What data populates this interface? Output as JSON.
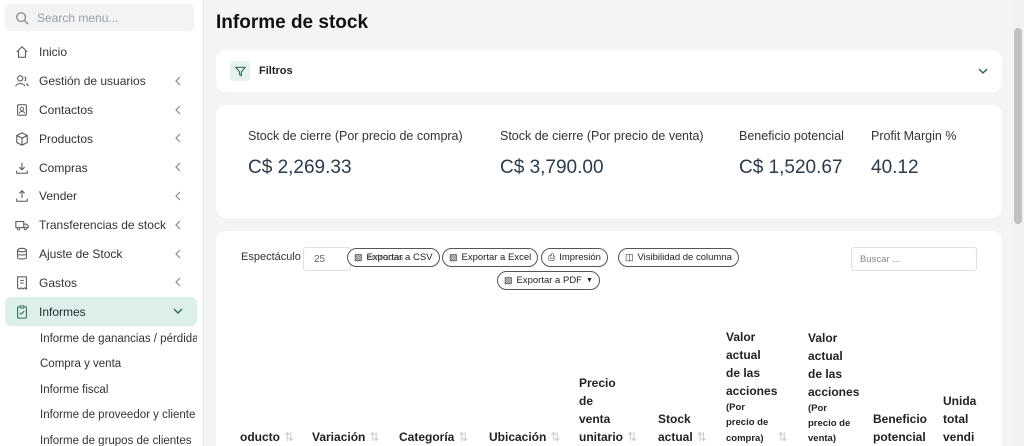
{
  "sidebar": {
    "search_placeholder": "Search menu...",
    "items": [
      {
        "label": "Inicio",
        "icon": "home-icon"
      },
      {
        "label": "Gestión de usuarios",
        "icon": "users-icon"
      },
      {
        "label": "Contactos",
        "icon": "address-book-icon"
      },
      {
        "label": "Productos",
        "icon": "box-icon"
      },
      {
        "label": "Compras",
        "icon": "download-icon"
      },
      {
        "label": "Vender",
        "icon": "upload-icon"
      },
      {
        "label": "Transferencias de stock",
        "icon": "truck-icon"
      },
      {
        "label": "Ajuste de Stock",
        "icon": "database-icon"
      },
      {
        "label": "Gastos",
        "icon": "receipt-icon"
      },
      {
        "label": "Informes",
        "icon": "report-icon"
      }
    ],
    "subitems": [
      "Informe de ganancias / pérdidas",
      "Compra y venta",
      "Informe fiscal",
      "Informe de proveedor y cliente",
      "Informe de grupos de clientes"
    ]
  },
  "page": {
    "title": "Informe de stock"
  },
  "filters": {
    "label": "Filtros"
  },
  "stats": [
    {
      "label": "Stock de cierre (Por precio de compra)",
      "value": "C$ 2,269.33"
    },
    {
      "label": "Stock de cierre (Por precio de venta)",
      "value": "C$ 3,790.00"
    },
    {
      "label": "Beneficio potencial",
      "value": "C$ 1,520.67"
    },
    {
      "label": "Profit Margin %",
      "value": "40.12"
    }
  ],
  "table": {
    "show_label": "Espectáculo",
    "page_size": "25",
    "overlap_text": "entradas",
    "buttons": {
      "csv": "Exportar a CSV",
      "excel": "Exportar a Excel",
      "print": "Impresión",
      "colvis": "Visibilidad de columna",
      "pdf": "Exportar a PDF"
    },
    "search_placeholder": "Buscar ...",
    "headers": {
      "producto": "oducto",
      "variacion": "Variación",
      "categoria": "Categoría",
      "ubicacion": "Ubicación",
      "precio": [
        "Precio",
        "de",
        "venta",
        "unitario"
      ],
      "stock": [
        "Stock",
        "actual"
      ],
      "valor_compra": [
        "Valor",
        "actual",
        "de las",
        "acciones"
      ],
      "valor_compra_sub": [
        "(Por",
        "precio de",
        "compra)"
      ],
      "valor_venta": [
        "Valor",
        "actual",
        "de las",
        "acciones"
      ],
      "valor_venta_sub": [
        "(Por",
        "precio de",
        "venta)"
      ],
      "beneficio": [
        "Beneficio",
        "potencial"
      ],
      "unidades": [
        "Unida",
        "total",
        "vendi"
      ]
    }
  }
}
